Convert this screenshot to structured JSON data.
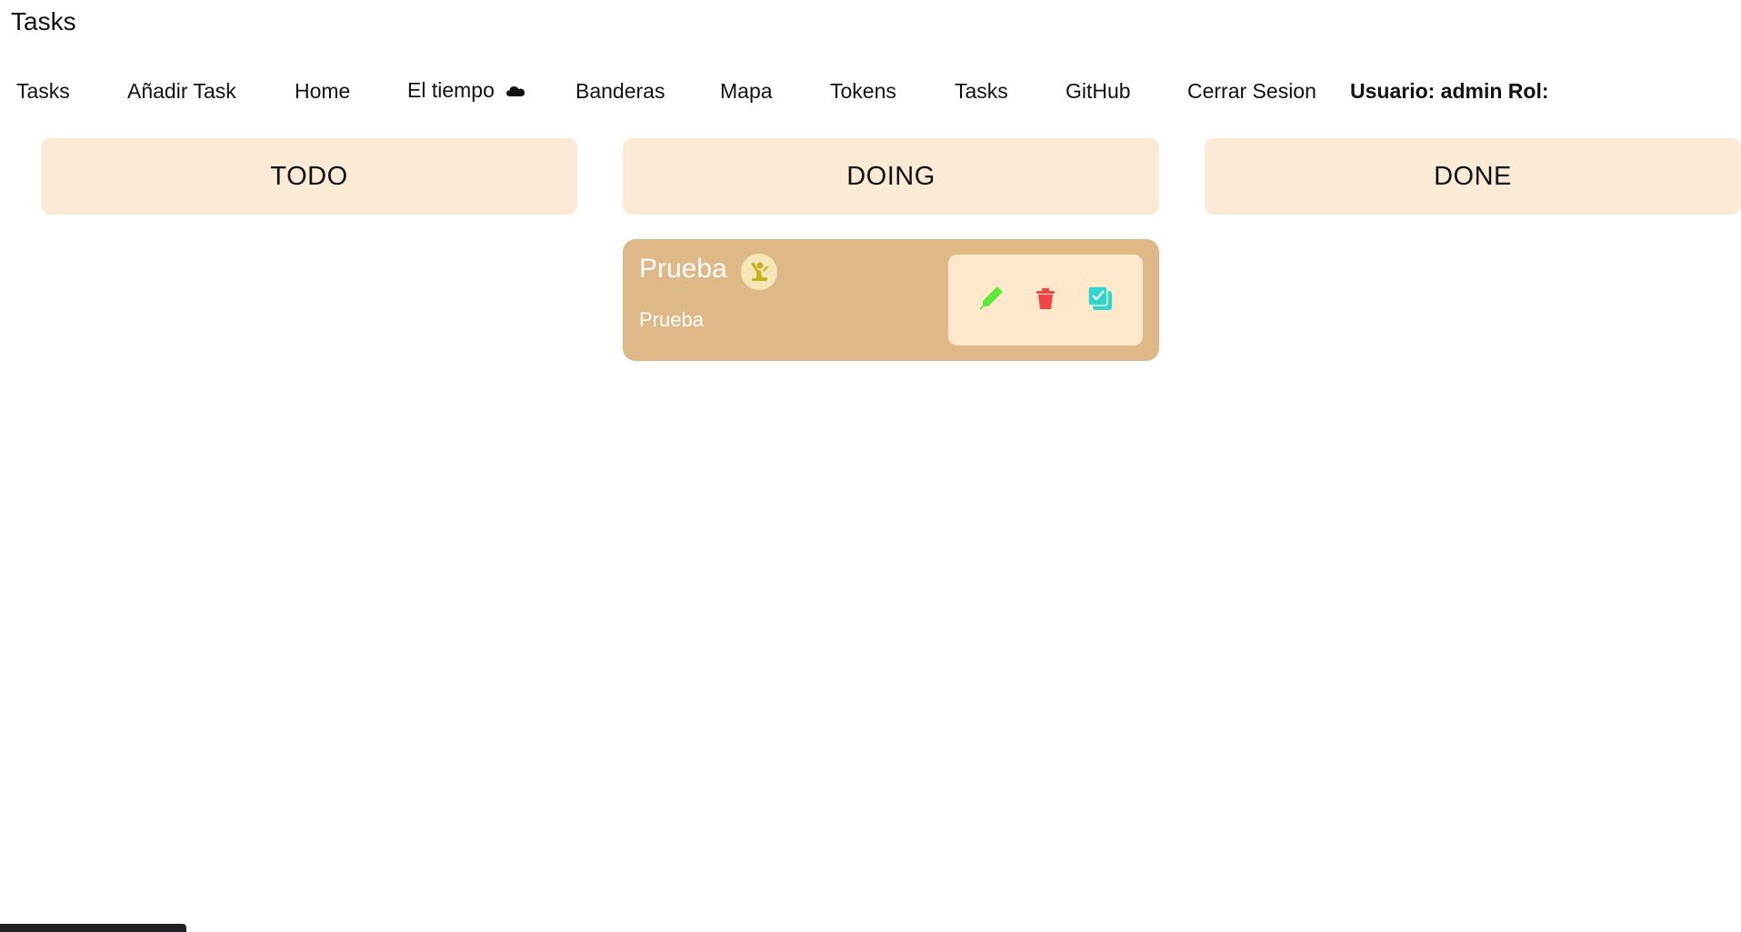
{
  "app": {
    "title": "Tasks"
  },
  "nav": {
    "items": [
      {
        "label": "Tasks"
      },
      {
        "label": "Añadir Task"
      },
      {
        "label": "Home"
      },
      {
        "label": "El tiempo",
        "icon": "cloud-icon"
      },
      {
        "label": "Banderas"
      },
      {
        "label": "Mapa"
      },
      {
        "label": "Tokens"
      },
      {
        "label": "Tasks"
      },
      {
        "label": "GitHub"
      },
      {
        "label": "Cerrar Sesion"
      }
    ],
    "user_info": "Usuario: admin Rol:"
  },
  "board": {
    "columns": [
      {
        "label": "TODO",
        "tasks": []
      },
      {
        "label": "DOING",
        "tasks": [
          {
            "title": "Prueba",
            "description": "Prueba",
            "avatar_icon": "person-icon",
            "actions": [
              {
                "name": "edit",
                "icon": "pencil-icon",
                "color": "#5ee83a"
              },
              {
                "name": "delete",
                "icon": "trash-icon",
                "color": "#f0434a"
              },
              {
                "name": "complete",
                "icon": "checkbox-icon",
                "color": "#2fd6d0"
              }
            ]
          }
        ]
      },
      {
        "label": "DONE",
        "tasks": []
      }
    ]
  },
  "colors": {
    "column_header_bg": "#faead6",
    "card_bg": "#deb887",
    "card_actions_bg": "#fde8cc",
    "avatar_bg": "#f5e6b8",
    "avatar_fg": "#c9b020"
  }
}
